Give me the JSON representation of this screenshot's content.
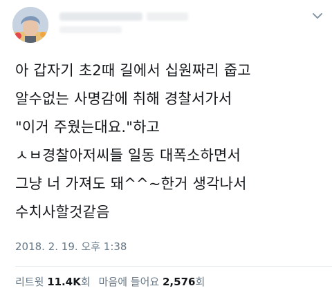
{
  "tweet": {
    "lines": [
      "아 갑자기 초2때 길에서 십원짜리 줍고",
      "알수없는 사명감에 취해 경찰서가서",
      "\"이거 주웠는대요.\"하고",
      "ㅅㅂ경찰아저씨들 일동 대폭소하면서",
      "그냥 너 가져도 돼^^~한거 생각나서",
      "수치사할것같음"
    ],
    "timestamp": "2018. 2. 19. 오후 1:38"
  },
  "stats": {
    "retweet_label": "리트윗",
    "retweet_count": "11.4K",
    "retweet_unit": "회",
    "like_label": "마음에 들어요",
    "like_count": "2,576",
    "like_unit": "회"
  },
  "icons": {
    "menu": "chevron-down-icon"
  },
  "colors": {
    "text": "#14171a",
    "secondary": "#657786",
    "divider": "#e6ecf0"
  }
}
